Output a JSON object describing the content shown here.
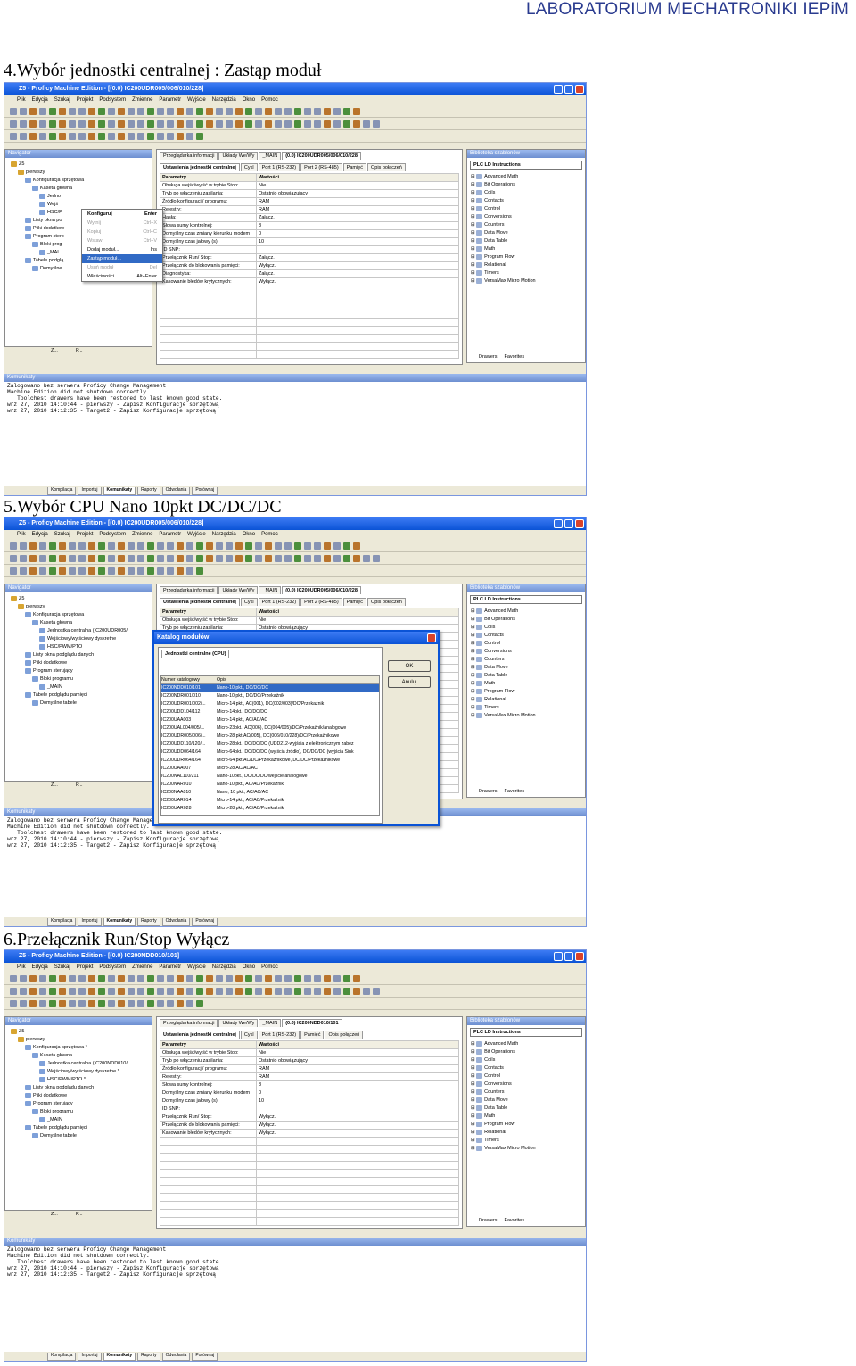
{
  "header": "LABORATORIUM MECHATRONIKI IEPiM",
  "sections": [
    {
      "caption": "4.Wybór jednostki centralnej : Zastąp moduł",
      "title": "Z5 - Proficy Machine Edition - [(0.0) IC200UDR005/006/010/228]",
      "tab": "(0.0) IC200UDR005/006/010/228"
    },
    {
      "caption": "5.Wybór CPU Nano 10pkt DC/DC/DC",
      "title": "Z5 - Proficy Machine Edition - [(0.0) IC200UDR005/006/010/228]",
      "tab": "(0.0) IC200UDR005/006/010/228"
    },
    {
      "caption": "6.Przełącznik Run/Stop Wyłącz",
      "title": "Z5 - Proficy Machine Edition - [(0.0) IC200NDD010/101]",
      "tab": "(0.0) IC200NDD010/101"
    }
  ],
  "menu": [
    "Plik",
    "Edycja",
    "Szukaj",
    "Projekt",
    "Podsystem",
    "Zmienne",
    "Parametr",
    "Wyjście",
    "Narzędzia",
    "Okno",
    "Pomoc"
  ],
  "navigator": {
    "title": "Navigator",
    "tree1": [
      "Z5",
      "pierwszy",
      "Konfiguracja sprzętowa",
      "Kaseta główna",
      "Jedno",
      "Wejś",
      "HSC/P",
      "Listy okna po",
      "Pliki dodatkow",
      "Program stero",
      "Bloki prog",
      "_MAI",
      "Tabele podglą",
      "Domyślne"
    ],
    "tree2": [
      "Z5",
      "pierwszy",
      "Konfiguracja sprzętowa",
      "Kaseta główna",
      "Jednostka centralna (IC200UDR005/",
      "Wejściowy/wyjściowy dyskretne",
      "HSC/PWM/PTO",
      "Listy okna podglądu danych",
      "Pliki dodatkowe",
      "Program sterujący",
      "Bloki programu",
      "_MAIN",
      "Tabele podglądu pamięci",
      "Domyślne tabele"
    ],
    "tree3": [
      "Z5",
      "pierwszy",
      "Konfiguracja sprzętowa *",
      "Kaseta główna",
      "Jednostka centralna (IC200NDD010/",
      "Wejściowy/wyjściowy dyskretne *",
      "HSC/PWM/PTO *",
      "Listy okna podglądu danych",
      "Pliki dodatkowe",
      "Program sterujący",
      "Bloki programu",
      "_MAIN",
      "Tabele podglądu pamięci",
      "Domyślne tabele"
    ]
  },
  "docTabs": [
    "Przeglądarka informacji",
    "Układy We/Wy",
    "_MAIN"
  ],
  "subTabs": [
    "Ustawienia jednostki centralnej",
    "Cykl",
    "Port 1 (RS-232)",
    "Port 2 (RS-485)",
    "Pamięć",
    "Opis połączeń"
  ],
  "subTabs3": [
    "Ustawienia jednostki centralnej",
    "Cykl",
    "Port 1 (RS-232)",
    "Pamięć",
    "Opis połączeń"
  ],
  "params": {
    "head": [
      "Parametry",
      "Wartości"
    ],
    "rows": [
      [
        "Obsługa wejść/wyjść w trybie Stop:",
        "Nie"
      ],
      [
        "Tryb po włączeniu zasilania:",
        "Ostatnio obowiązujący"
      ],
      [
        "Źródło konfiguracji/ programu:",
        "RAM"
      ],
      [
        "Rejestry:",
        "RAM"
      ],
      [
        "Hasła:",
        "Załącz."
      ],
      [
        "Słowa sumy kontrolnej:",
        "8"
      ],
      [
        "Domyślny czas zmiany kierunku modem",
        "0"
      ],
      [
        "Domyślny czas jałowy (s):",
        "10"
      ],
      [
        "ID SNP:",
        ""
      ],
      [
        "Przełącznik Run/ Stop:",
        "Załącz."
      ],
      [
        "Przełącznik do blokowania pamięci:",
        "Wyłącz."
      ],
      [
        "Diagnostyka:",
        "Załącz."
      ],
      [
        "Kasowanie błędów krytycznych:",
        "Wyłącz."
      ]
    ],
    "rows3": [
      [
        "Obsługa wejść/wyjść w trybie Stop:",
        "Nie"
      ],
      [
        "Tryb po włączeniu zasilania:",
        "Ostatnio obowiązujący"
      ],
      [
        "Źródło konfiguracji/ programu:",
        "RAM"
      ],
      [
        "Rejestry:",
        "RAM"
      ],
      [
        "Słowa sumy kontrolnej:",
        "8"
      ],
      [
        "Domyślny czas zmiany kierunku modem",
        "0"
      ],
      [
        "Domyślny czas jałowy (s):",
        "10"
      ],
      [
        "ID SNP:",
        ""
      ],
      [
        "Przełącznik Run/ Stop:",
        "Wyłącz."
      ],
      [
        "Przełącznik do blokowania pamięci:",
        "Wyłącz."
      ],
      [
        "Kasowanie błędów krytycznych:",
        "Wyłącz."
      ]
    ]
  },
  "library": {
    "title": "Biblioteka szablonów",
    "combo": "PLC LD Instructions",
    "items": [
      "Advanced Math",
      "Bit Operations",
      "Coils",
      "Contacts",
      "Control",
      "Conversions",
      "Counters",
      "Data Move",
      "Data Table",
      "Math",
      "Program Flow",
      "Relational",
      "Timers",
      "VersaMax Micro Motion"
    ],
    "tabs": [
      "Drawers",
      "Favorites"
    ]
  },
  "navTabs": [
    "Z...",
    "P..."
  ],
  "messages": {
    "title": "Komunikaty",
    "lines": [
      "Zalogowano bez serwera Proficy Change Management",
      "Machine Edition did not shutdown correctly.",
      "   Toolchest drawers have been restored to last known good state.",
      "wrz 27, 2010 14:10:44 - pierwszy - Zapisz Konfiguracje sprzętową",
      "wrz 27, 2010 14:12:35 - Target2 - Zapisz Konfiguracje sprzętową"
    ]
  },
  "bottomTabs": [
    "Kompilacja",
    "Importuj",
    "Komunikaty",
    "Raporty",
    "Odwołania",
    "Porównaj"
  ],
  "contextMenu": [
    [
      "Konfiguruj",
      "Enter"
    ],
    [
      "Wytnij",
      "Ctrl+X"
    ],
    [
      "Kopiuj",
      "Ctrl+C"
    ],
    [
      "Wstaw",
      "Ctrl+V"
    ],
    [
      "Dodaj moduł...",
      "Ins"
    ],
    [
      "Zastąp moduł...",
      ""
    ],
    [
      "Usuń moduł",
      "Del"
    ],
    [
      "Właściwości",
      "Alt+Enter"
    ]
  ],
  "catalog": {
    "title": "Katalog modułów",
    "tab": "Jednostki centralne (CPU)",
    "cols": [
      "Numer katalogowy",
      "Opis"
    ],
    "ok": "OK",
    "cancel": "Anuluj",
    "rows": [
      [
        "IC200NDD010/101",
        "Nano-10 pkt., DC/DC/DC"
      ],
      [
        "IC200NDR001/010",
        "Nano-10 pkt., DC/DC/Przekaźnik"
      ],
      [
        "IC200UDR001/002/...",
        "Micro-14 pkt., AC(001), DC(002/003)/DC/Przekaźnik"
      ],
      [
        "IC200UDD104/112",
        "Micro-14pkt., DC/DC/DC"
      ],
      [
        "IC200UAA003",
        "Micro-14 pkt., AC/AC/AC"
      ],
      [
        "IC200UAL004/005/...",
        "Micro-23pkt., AC(006), DC(004/005)/DC/Przekaźnik/analogowe"
      ],
      [
        "IC200UDR005/006/...",
        "Micro-28 pkt,AC(005), DC(006/010/228)/DC/Przekaźnikowe"
      ],
      [
        "IC200UDD110/120/...",
        "Micro-28pkt., DC/DC/DC (UDD212-wyjścia z elektronicznym zabez"
      ],
      [
        "IC200UDD064/164",
        "Micro-64pkt., DC/DC/DC (wyjścia źródło), DC/DC/DC (wyjścia Sink"
      ],
      [
        "IC200UDR064/164",
        "Micro-64 pkt,AC/DC/Przekaźnikowe, DC/DC/Przekaźnikowe"
      ],
      [
        "IC200UAA007",
        "Micro-28 AC/AC/AC"
      ],
      [
        "IC200NAL110/211",
        "Nano-10pkt., DC/DC/DC/wejście analogowe"
      ],
      [
        "IC200NAR010",
        "Nano-10 pkt., AC/AC/Przekaźnik"
      ],
      [
        "IC200NAA010",
        "Nano, 10 pkt., AC/AC/AC"
      ],
      [
        "IC200UAR014",
        "Micro-14 pkt., AC/AC/Przekaźnik"
      ],
      [
        "IC200UAR028",
        "Micro-28 pkt., AC/AC/Przekaźnik"
      ]
    ]
  },
  "colors": {
    "title": "#0a53d6",
    "selection": "#316ac5",
    "header": "#2a3b8f"
  }
}
